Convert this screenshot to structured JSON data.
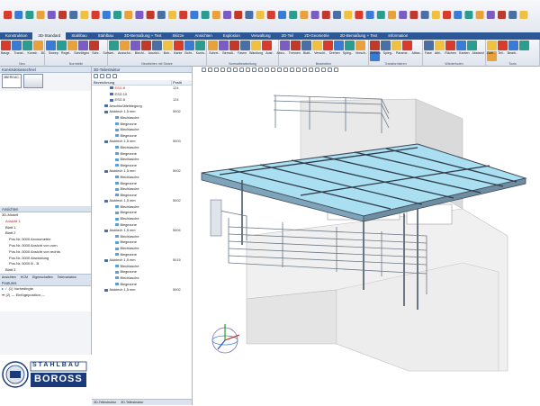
{
  "ribbon_tabs": [
    "Konstruktion",
    "3D-Standard",
    "Stahlbau",
    "Stahlbau",
    "3D-Bemaßung + Text",
    "Skizze",
    "Ansichten",
    "Explosion",
    "Verwaltung",
    "2D-Teil",
    "2D-Geometrie",
    "2D-Bemaßung + Text",
    "Information"
  ],
  "ribbon_groups": [
    "Neu",
    "Normteile",
    "Bearbeiten mit Stutze",
    "Normalbearbeitung",
    "Bearbeiten",
    "Transformieren",
    "Wiederholen",
    "Tools"
  ],
  "ribbon_small_labels": [
    "Baugr..",
    "Transf..",
    "Konstr..",
    "Bl..",
    "Sweep",
    "Regel..",
    "Schnittgeo",
    "Schr..",
    "Schwei..",
    "Ausschn..",
    "Blechl..",
    "Ausrich..",
    "Boh..",
    "Kante",
    "Bohr..",
    "Kontu..",
    "Schrei..",
    "Bemaß..",
    "Fasen",
    "Wandung",
    "Ausf..",
    "Abzu..",
    "Trennen",
    "Blatt..",
    "Verschi..",
    "Drehen",
    "Spieg..",
    "Versch..",
    "Drehen",
    "Spieg..",
    "Parame..",
    "Attrac..",
    "Fase",
    "Attri..",
    "Flächen",
    "Kanten",
    "Abstand",
    "Zwei..",
    "Teil..",
    "Bearb.."
  ],
  "left_panel": {
    "header": "Konstruktionsechnel",
    "thumbnails": [
      "3BERDAC..",
      ""
    ],
    "views_header": "Ansichten",
    "tree": [
      "3D-Modell",
      "Ansicht 1",
      "Blatt 1",
      "Blatt 2",
      "Pos.Nr.:3000 Axonometrie",
      "Pos.Nr.:3000 Ansicht von vorn",
      "Pos.Nr.:3000 Ansicht von rechts",
      "Pos.Nr.:3000 Abwicklung",
      "Pos.Nr.:3000 B - B",
      "Blatt 3"
    ],
    "tabs": [
      "Ansichten",
      "HCM",
      "Eigenschaften",
      "Teilevariation"
    ],
    "features_header": "Features",
    "features": [
      "(1) Vorbedingte",
      "(2) --- Einfügeposition ---"
    ]
  },
  "structure": {
    "header": "3D-Teilestruktur",
    "col_name": "Bezeichnung",
    "col_pos": "Positi",
    "rows": [
      {
        "name": "ESG 8",
        "pos": "124",
        "red": true
      },
      {
        "name": "ESG 10",
        "pos": ""
      },
      {
        "name": "ESG 8",
        "pos": "124"
      },
      {
        "name": "Anschlußbleibiegung",
        "pos": ""
      },
      {
        "name": "Alublech 1,5 mm",
        "pos": "5002"
      },
      {
        "name": "Blechlasche",
        "pos": ""
      },
      {
        "name": "Biegezone",
        "pos": ""
      },
      {
        "name": "Blechlasche",
        "pos": ""
      },
      {
        "name": "Biegezone",
        "pos": ""
      },
      {
        "name": "Alublech 1,5 mm",
        "pos": "5003"
      },
      {
        "name": "Blechlasche",
        "pos": ""
      },
      {
        "name": "Biegezone",
        "pos": ""
      },
      {
        "name": "Blechlasche",
        "pos": ""
      },
      {
        "name": "Biegezone",
        "pos": ""
      },
      {
        "name": "Alublech 1,5 mm",
        "pos": "5002"
      },
      {
        "name": "Blechlasche",
        "pos": ""
      },
      {
        "name": "Biegezone",
        "pos": ""
      },
      {
        "name": "Blechlasche",
        "pos": ""
      },
      {
        "name": "Biegezone",
        "pos": ""
      },
      {
        "name": "Alublech 1,5 mm",
        "pos": "5002"
      },
      {
        "name": "Blechlasche",
        "pos": ""
      },
      {
        "name": "Biegezone",
        "pos": ""
      },
      {
        "name": "Blechlasche",
        "pos": ""
      },
      {
        "name": "Biegezone",
        "pos": ""
      },
      {
        "name": "Alublech 1,5 mm",
        "pos": "5004"
      },
      {
        "name": "Blechlasche",
        "pos": ""
      },
      {
        "name": "Biegezone",
        "pos": ""
      },
      {
        "name": "Blechlasche",
        "pos": ""
      },
      {
        "name": "Biegezone",
        "pos": ""
      },
      {
        "name": "Alublech 1,5 mm",
        "pos": "5015"
      },
      {
        "name": "Blechlasche",
        "pos": ""
      },
      {
        "name": "Biegezone",
        "pos": ""
      },
      {
        "name": "Blechlasche",
        "pos": ""
      },
      {
        "name": "Biegezone",
        "pos": ""
      },
      {
        "name": "Alublech 1,5 mm",
        "pos": "5002"
      }
    ],
    "bottom_tabs": [
      "3D-Teilestruktur",
      "3D-Teilestruktur"
    ]
  },
  "logo": {
    "line1": "STAHLBAU",
    "line2": "BOROSS"
  },
  "colors": {
    "ribbon_blue": "#2b5797",
    "red": "#c01818",
    "glass": "#8fd3ea",
    "steel": "#3c4a5a"
  }
}
